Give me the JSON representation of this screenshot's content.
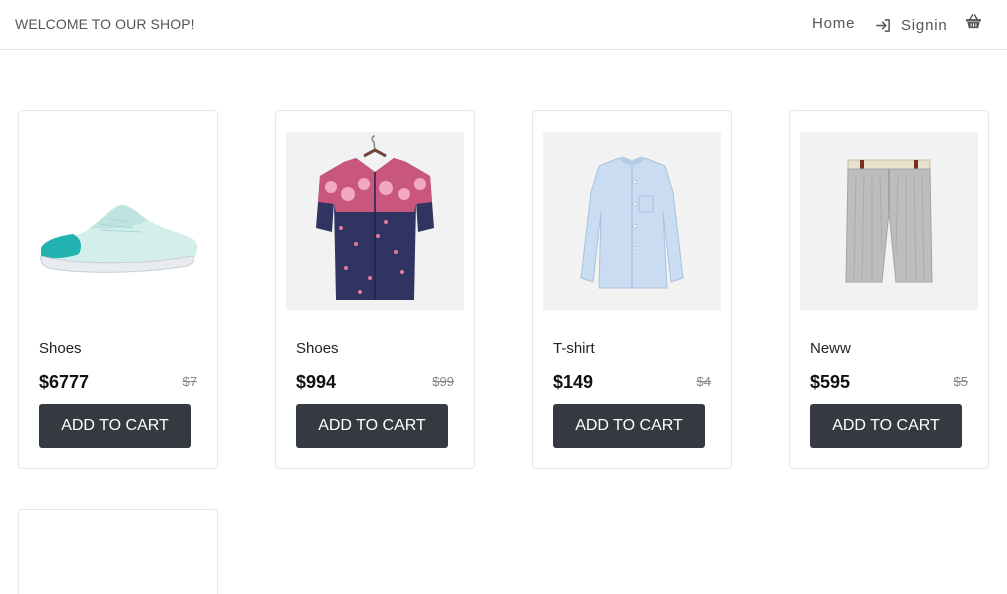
{
  "header": {
    "welcome": "WELCOME TO OUR SHOP!",
    "nav": {
      "home_label": "Home",
      "signin_label": "Signin",
      "signin_icon": "sign-in-arrow-icon",
      "cart_icon": "shopping-basket-icon"
    }
  },
  "products": [
    {
      "name": "Shoes",
      "price": "$6777",
      "old_price": "$7",
      "button_label": "ADD TO CART",
      "image": "sneaker"
    },
    {
      "name": "Shoes",
      "price": "$994",
      "old_price": "$99",
      "button_label": "ADD TO CART",
      "image": "floral-shirt"
    },
    {
      "name": "T-shirt",
      "price": "$149",
      "old_price": "$4",
      "button_label": "ADD TO CART",
      "image": "blue-shirt"
    },
    {
      "name": "Neww",
      "price": "$595",
      "old_price": "$5",
      "button_label": "ADD TO CART",
      "image": "grey-shorts"
    }
  ],
  "colors": {
    "button_bg": "#343a40",
    "button_text": "#ffffff",
    "border": "#e8e8e8"
  }
}
